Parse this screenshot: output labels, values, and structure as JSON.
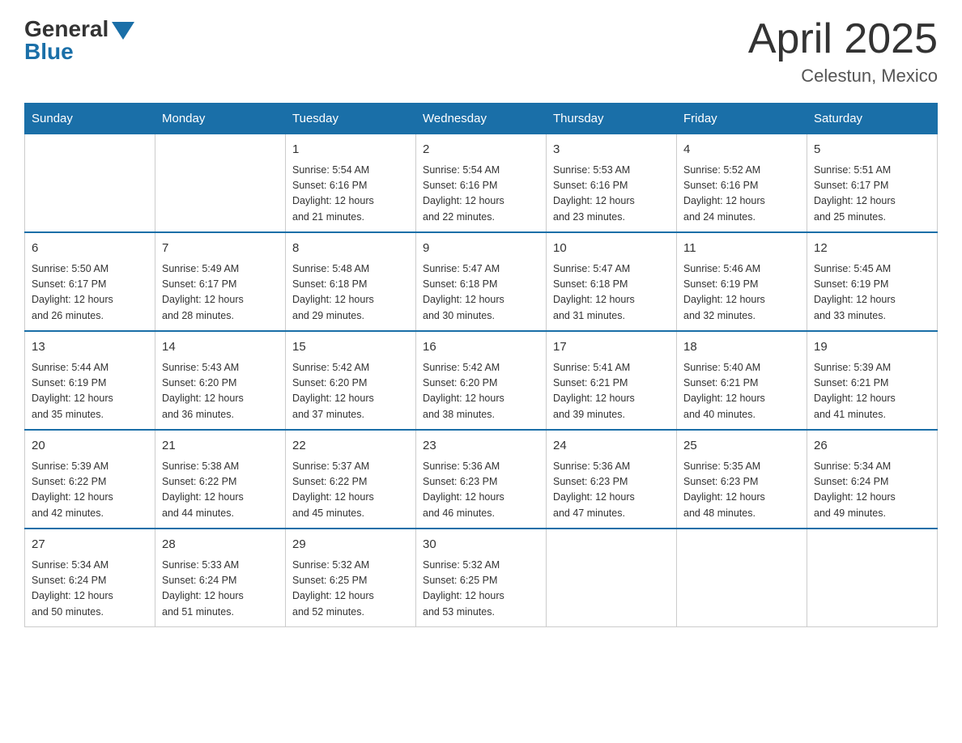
{
  "header": {
    "logo_general": "General",
    "logo_blue": "Blue",
    "month_title": "April 2025",
    "location": "Celestun, Mexico"
  },
  "calendar": {
    "days_of_week": [
      "Sunday",
      "Monday",
      "Tuesday",
      "Wednesday",
      "Thursday",
      "Friday",
      "Saturday"
    ],
    "weeks": [
      [
        {
          "day": "",
          "info": ""
        },
        {
          "day": "",
          "info": ""
        },
        {
          "day": "1",
          "info": "Sunrise: 5:54 AM\nSunset: 6:16 PM\nDaylight: 12 hours\nand 21 minutes."
        },
        {
          "day": "2",
          "info": "Sunrise: 5:54 AM\nSunset: 6:16 PM\nDaylight: 12 hours\nand 22 minutes."
        },
        {
          "day": "3",
          "info": "Sunrise: 5:53 AM\nSunset: 6:16 PM\nDaylight: 12 hours\nand 23 minutes."
        },
        {
          "day": "4",
          "info": "Sunrise: 5:52 AM\nSunset: 6:16 PM\nDaylight: 12 hours\nand 24 minutes."
        },
        {
          "day": "5",
          "info": "Sunrise: 5:51 AM\nSunset: 6:17 PM\nDaylight: 12 hours\nand 25 minutes."
        }
      ],
      [
        {
          "day": "6",
          "info": "Sunrise: 5:50 AM\nSunset: 6:17 PM\nDaylight: 12 hours\nand 26 minutes."
        },
        {
          "day": "7",
          "info": "Sunrise: 5:49 AM\nSunset: 6:17 PM\nDaylight: 12 hours\nand 28 minutes."
        },
        {
          "day": "8",
          "info": "Sunrise: 5:48 AM\nSunset: 6:18 PM\nDaylight: 12 hours\nand 29 minutes."
        },
        {
          "day": "9",
          "info": "Sunrise: 5:47 AM\nSunset: 6:18 PM\nDaylight: 12 hours\nand 30 minutes."
        },
        {
          "day": "10",
          "info": "Sunrise: 5:47 AM\nSunset: 6:18 PM\nDaylight: 12 hours\nand 31 minutes."
        },
        {
          "day": "11",
          "info": "Sunrise: 5:46 AM\nSunset: 6:19 PM\nDaylight: 12 hours\nand 32 minutes."
        },
        {
          "day": "12",
          "info": "Sunrise: 5:45 AM\nSunset: 6:19 PM\nDaylight: 12 hours\nand 33 minutes."
        }
      ],
      [
        {
          "day": "13",
          "info": "Sunrise: 5:44 AM\nSunset: 6:19 PM\nDaylight: 12 hours\nand 35 minutes."
        },
        {
          "day": "14",
          "info": "Sunrise: 5:43 AM\nSunset: 6:20 PM\nDaylight: 12 hours\nand 36 minutes."
        },
        {
          "day": "15",
          "info": "Sunrise: 5:42 AM\nSunset: 6:20 PM\nDaylight: 12 hours\nand 37 minutes."
        },
        {
          "day": "16",
          "info": "Sunrise: 5:42 AM\nSunset: 6:20 PM\nDaylight: 12 hours\nand 38 minutes."
        },
        {
          "day": "17",
          "info": "Sunrise: 5:41 AM\nSunset: 6:21 PM\nDaylight: 12 hours\nand 39 minutes."
        },
        {
          "day": "18",
          "info": "Sunrise: 5:40 AM\nSunset: 6:21 PM\nDaylight: 12 hours\nand 40 minutes."
        },
        {
          "day": "19",
          "info": "Sunrise: 5:39 AM\nSunset: 6:21 PM\nDaylight: 12 hours\nand 41 minutes."
        }
      ],
      [
        {
          "day": "20",
          "info": "Sunrise: 5:39 AM\nSunset: 6:22 PM\nDaylight: 12 hours\nand 42 minutes."
        },
        {
          "day": "21",
          "info": "Sunrise: 5:38 AM\nSunset: 6:22 PM\nDaylight: 12 hours\nand 44 minutes."
        },
        {
          "day": "22",
          "info": "Sunrise: 5:37 AM\nSunset: 6:22 PM\nDaylight: 12 hours\nand 45 minutes."
        },
        {
          "day": "23",
          "info": "Sunrise: 5:36 AM\nSunset: 6:23 PM\nDaylight: 12 hours\nand 46 minutes."
        },
        {
          "day": "24",
          "info": "Sunrise: 5:36 AM\nSunset: 6:23 PM\nDaylight: 12 hours\nand 47 minutes."
        },
        {
          "day": "25",
          "info": "Sunrise: 5:35 AM\nSunset: 6:23 PM\nDaylight: 12 hours\nand 48 minutes."
        },
        {
          "day": "26",
          "info": "Sunrise: 5:34 AM\nSunset: 6:24 PM\nDaylight: 12 hours\nand 49 minutes."
        }
      ],
      [
        {
          "day": "27",
          "info": "Sunrise: 5:34 AM\nSunset: 6:24 PM\nDaylight: 12 hours\nand 50 minutes."
        },
        {
          "day": "28",
          "info": "Sunrise: 5:33 AM\nSunset: 6:24 PM\nDaylight: 12 hours\nand 51 minutes."
        },
        {
          "day": "29",
          "info": "Sunrise: 5:32 AM\nSunset: 6:25 PM\nDaylight: 12 hours\nand 52 minutes."
        },
        {
          "day": "30",
          "info": "Sunrise: 5:32 AM\nSunset: 6:25 PM\nDaylight: 12 hours\nand 53 minutes."
        },
        {
          "day": "",
          "info": ""
        },
        {
          "day": "",
          "info": ""
        },
        {
          "day": "",
          "info": ""
        }
      ]
    ]
  }
}
